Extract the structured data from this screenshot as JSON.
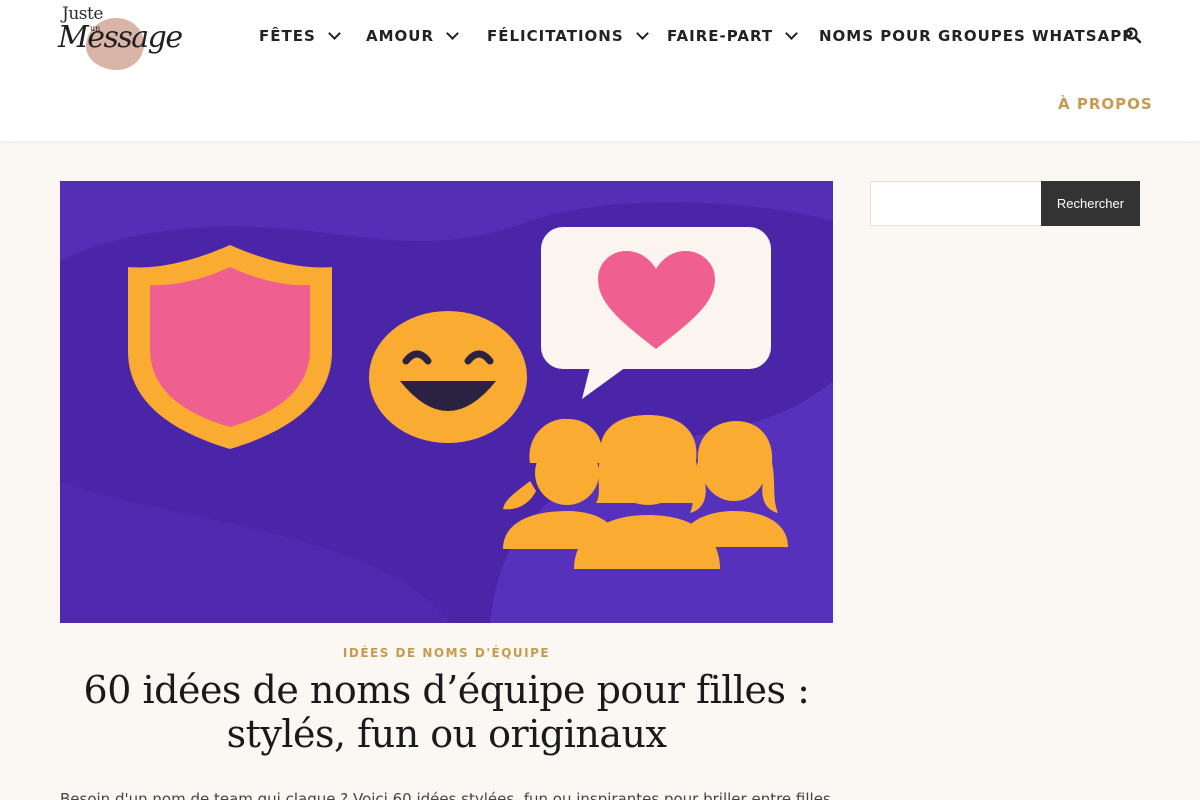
{
  "logo": {
    "line1": "Juste",
    "line2": "un",
    "line3": "Message"
  },
  "nav": {
    "items": [
      {
        "label": "FÊTES",
        "has_dropdown": true
      },
      {
        "label": "AMOUR",
        "has_dropdown": true
      },
      {
        "label": "FÉLICITATIONS",
        "has_dropdown": true
      },
      {
        "label": "FAIRE-PART",
        "has_dropdown": true
      },
      {
        "label": "NOMS POUR GROUPES WHATSAPP",
        "has_dropdown": false
      }
    ],
    "secondary_item": "À PROPOS",
    "search_icon": "search-icon"
  },
  "sidebar": {
    "search_placeholder": "",
    "search_button": "Rechercher"
  },
  "article": {
    "category": "IDÉES DE NOMS D'ÉQUIPE",
    "title_line1": "60 idées de noms d’équipe pour filles :",
    "title_line2": "stylés, fun ou originaux",
    "excerpt": "Besoin d'un nom de team qui claque ? Voici 60 idées stylées, fun ou inspirantes pour briller entre filles, sur le"
  },
  "colors": {
    "accent": "#c79a4f",
    "hero_background": "#4a25a8",
    "hero_pink": "#f0608f",
    "hero_orange": "#f9ab32",
    "button_dark": "#333333",
    "page_background": "#fbf8f3"
  }
}
